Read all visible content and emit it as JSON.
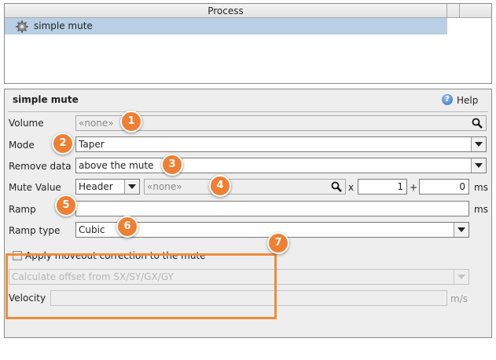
{
  "process_table": {
    "header": "Process",
    "rows": [
      {
        "label": "simple mute",
        "icon": "gear-icon"
      }
    ]
  },
  "editor": {
    "title": "simple mute",
    "help_label": "Help",
    "volume": {
      "label": "Volume",
      "value": "«none»"
    },
    "mode": {
      "label": "Mode",
      "value": "Taper"
    },
    "remove_data": {
      "label": "Remove data",
      "value": "above the mute"
    },
    "mute_value": {
      "label": "Mute Value",
      "source": "Header",
      "header_value": "«none»",
      "times_symbol": "x",
      "multiplier": "1",
      "plus_symbol": "+",
      "offset": "0",
      "unit": "ms"
    },
    "ramp": {
      "label": "Ramp",
      "value": "",
      "unit": "ms"
    },
    "ramp_type": {
      "label": "Ramp type",
      "value": "Cubic"
    },
    "moveout": {
      "checkbox_label": "Apply moveout correction to the mute",
      "checked": false,
      "offset_option": "Calculate offset from SX/SY/GX/GY",
      "velocity_label": "Velocity",
      "velocity_value": "",
      "velocity_unit": "m/s"
    }
  },
  "callouts": [
    "1",
    "2",
    "3",
    "4",
    "5",
    "6",
    "7"
  ],
  "colors": {
    "selection": "#b8cfe5",
    "callout": "#ef7f33",
    "highlight_border": "#ef8c3a"
  }
}
